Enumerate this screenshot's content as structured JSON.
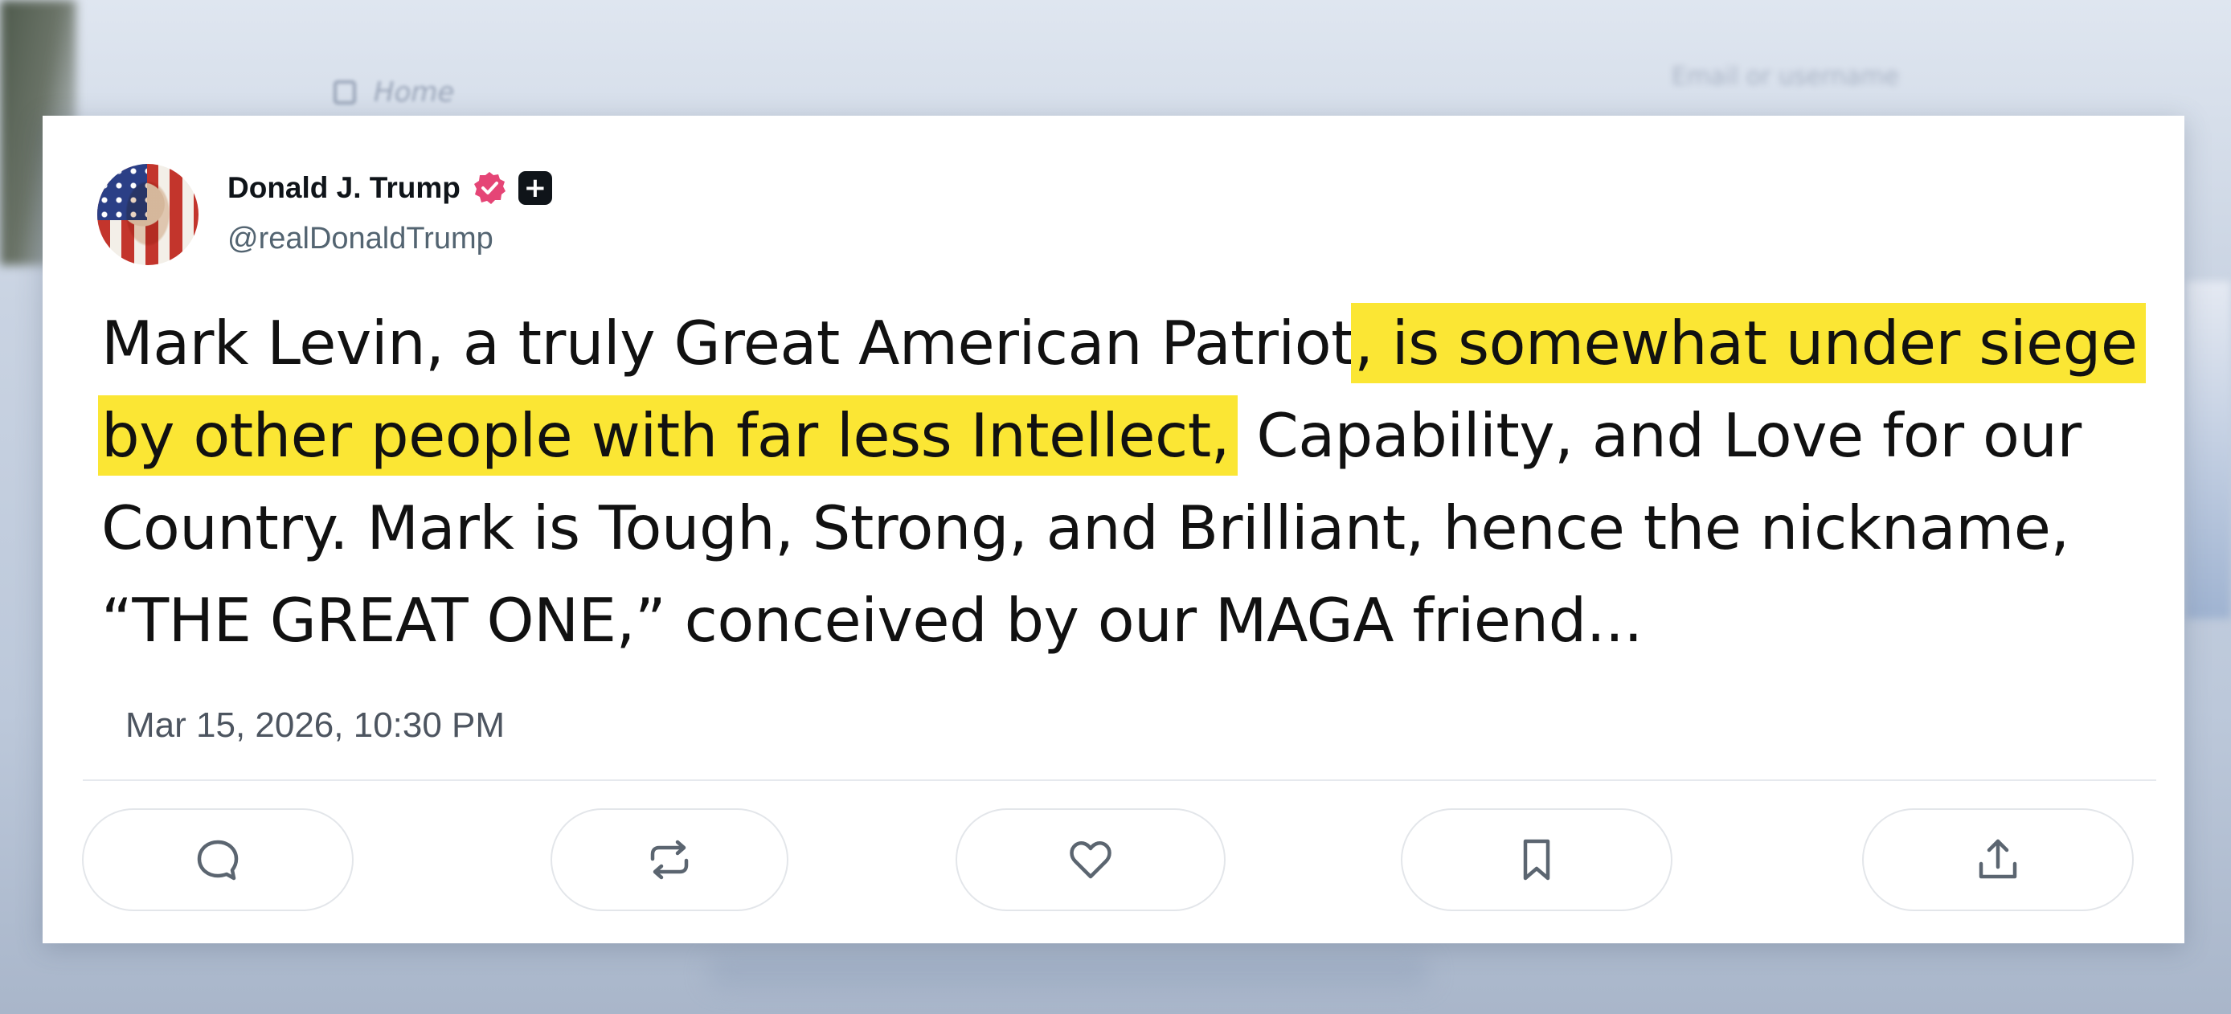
{
  "background": {
    "nav_home_label": "Home",
    "email_placeholder": "Email or username"
  },
  "post": {
    "author": {
      "display_name": "Donald J. Trump",
      "handle": "@realDonaldTrump",
      "verified_badge_color": "#e0245e",
      "badges": [
        "verified-badge-icon",
        "plus-badge-icon"
      ]
    },
    "text_segments": {
      "plain_1": "Mark Levin, a truly Great American Patriot",
      "highlight": ", is somewhat under siege by other people with far less Intellect,",
      "plain_2": " Capability, and Love for our Country. Mark is Tough, Strong, and Brilliant, hence the nickname, “THE GREAT ONE,” conceived by our MAGA friend..."
    },
    "highlight_color": "#fbe634",
    "timestamp": "Mar 15, 2026, 10:30 PM",
    "actions": [
      {
        "name": "reply",
        "icon": "reply-icon"
      },
      {
        "name": "repost",
        "icon": "repost-icon"
      },
      {
        "name": "like",
        "icon": "heart-icon"
      },
      {
        "name": "bookmark",
        "icon": "bookmark-icon"
      },
      {
        "name": "share",
        "icon": "share-icon"
      }
    ]
  }
}
